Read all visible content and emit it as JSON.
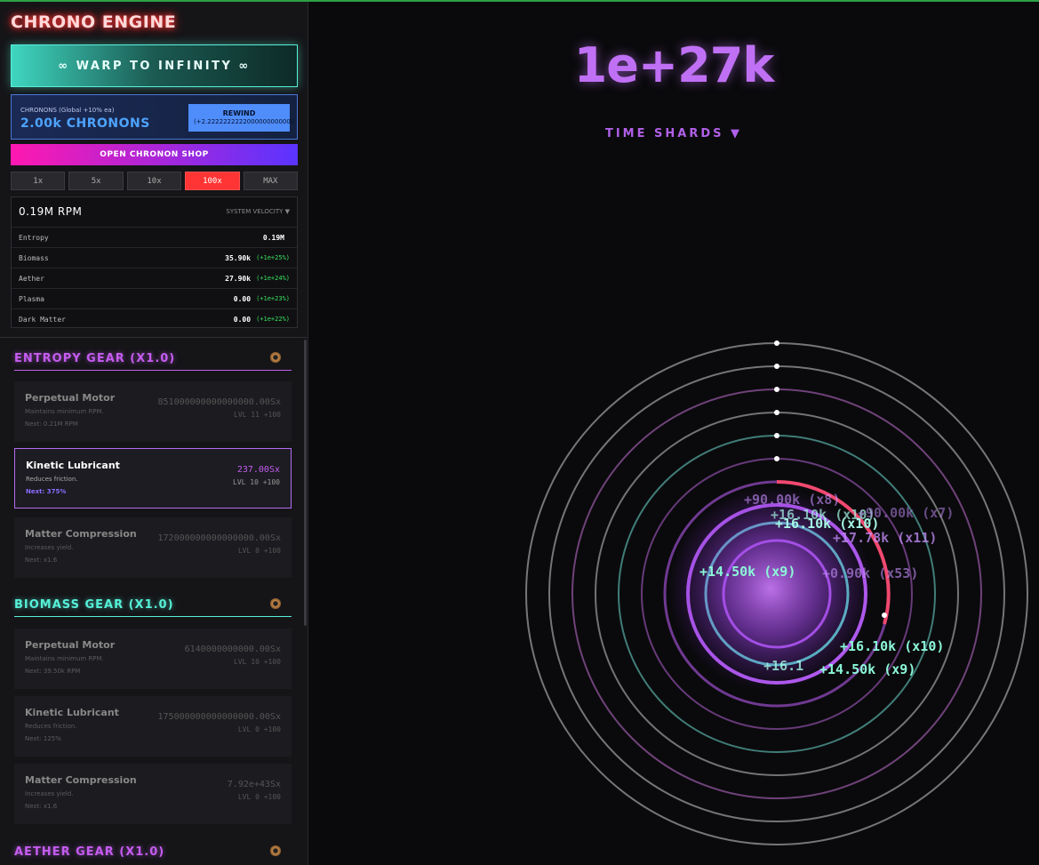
{
  "app": {
    "title": "CHRONO ENGINE"
  },
  "warp_button": {
    "label": "∞ WARP TO INFINITY ∞"
  },
  "chronons": {
    "label": "CHRONONS (Global +10% ea)",
    "value": "2.00k CHRONONS",
    "rewind_label": "REWIND",
    "rewind_sub": "(+2.2222222222000000000000"
  },
  "shop_button": {
    "label": "OPEN CHRONON SHOP"
  },
  "multipliers": [
    "1x",
    "5x",
    "10x",
    "100x",
    "MAX"
  ],
  "velocity": {
    "rpm": "0.19M RPM",
    "label": "SYSTEM VELOCITY ▼",
    "resources": [
      {
        "name": "Entropy",
        "value": "0.19M",
        "rate": ""
      },
      {
        "name": "Biomass",
        "value": "35.90k",
        "rate": "(+1e+25%)"
      },
      {
        "name": "Aether",
        "value": "27.90k",
        "rate": "(+1e+24%)"
      },
      {
        "name": "Plasma",
        "value": "0.00",
        "rate": "(+1e+23%)"
      },
      {
        "name": "Dark Matter",
        "value": "0.00",
        "rate": "(+1e+22%)"
      }
    ]
  },
  "gears": [
    {
      "title": "ENTROPY GEAR (X1.0)",
      "upgrades": [
        {
          "name": "Perpetual Motor",
          "desc": "Maintains minimum RPM.",
          "next": "Next: 0.21M RPM",
          "mult": "851000000000000000.00Sx",
          "lvl": "LVL 11 +100"
        },
        {
          "name": "Kinetic Lubricant",
          "desc": "Reduces friction.",
          "next": "Next: 375%",
          "mult": "237.00Sx",
          "lvl": "LVL 10 +100"
        },
        {
          "name": "Matter Compression",
          "desc": "Increases yield.",
          "next": "Next: x1.6",
          "mult": "172000000000000000.00Sx",
          "lvl": "LVL 0 +100"
        }
      ]
    },
    {
      "title": "BIOMASS GEAR (X1.0)",
      "upgrades": [
        {
          "name": "Perpetual Motor",
          "desc": "Maintains minimum RPM.",
          "next": "Next: 39.50k RPM",
          "mult": "6140000000000.00Sx",
          "lvl": "LVL 10 +100"
        },
        {
          "name": "Kinetic Lubricant",
          "desc": "Reduces friction.",
          "next": "Next: 125%",
          "mult": "175000000000000000.00Sx",
          "lvl": "LVL 0 +100"
        },
        {
          "name": "Matter Compression",
          "desc": "Increases yield.",
          "next": "Next: x1.6",
          "mult": "7.92e+43Sx",
          "lvl": "LVL 0 +100"
        }
      ]
    },
    {
      "title": "AETHER GEAR (X1.0)",
      "upgrades": []
    }
  ],
  "main": {
    "shards": "1e+27k",
    "shards_label": "TIME SHARDS ▼",
    "floating_texts": [
      "+16.10k (x10)",
      "+14.50k (x9)",
      "+17.78k (x11)",
      "+16.10k (x10)",
      "+14.50k (x9)",
      "+16.1",
      "+90.00k (x8)",
      "+0.90k (x53)",
      "+16.10k (x10)",
      "+90.00k (x7)"
    ]
  },
  "colors": {
    "accent_purple": "#c070f5",
    "accent_teal": "#56f0d8",
    "accent_red": "#ff3434"
  }
}
